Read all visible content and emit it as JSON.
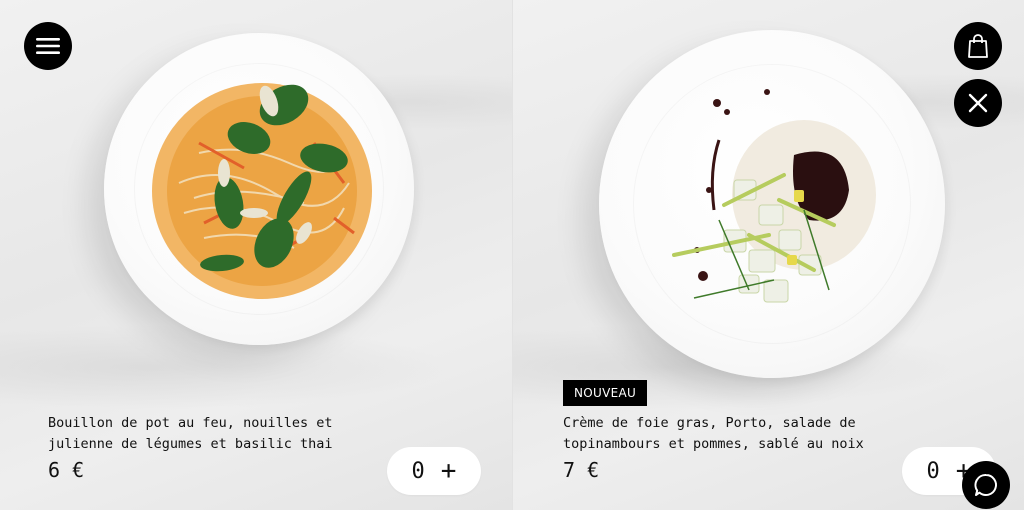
{
  "icons": {
    "menu": "menu-icon",
    "bag": "shopping-bag-icon",
    "close": "close-icon",
    "chat": "chat-icon",
    "plus": "plus-icon"
  },
  "colors": {
    "button_background": "#000000",
    "button_foreground": "#ffffff",
    "text": "#111111",
    "quantity_pill": "#ffffff"
  },
  "products": [
    {
      "description": "Bouillon de pot au feu, nouilles et julienne de légumes et basilic thai",
      "description_line1": "Bouillon de pot au feu, nouilles et",
      "description_line2": "julienne de légumes et basilic thai",
      "price": "6 €",
      "quantity": "0",
      "plus_label": "+"
    },
    {
      "badge": "NOUVEAU",
      "description": "Crème de foie gras, Porto, salade de topinambours et pommes, sablé au noix",
      "description_line1": "Crème de foie gras, Porto, salade de",
      "description_line2": "topinambours et pommes, sablé au noix",
      "price": "7 €",
      "quantity": "0",
      "plus_label": "+"
    }
  ]
}
